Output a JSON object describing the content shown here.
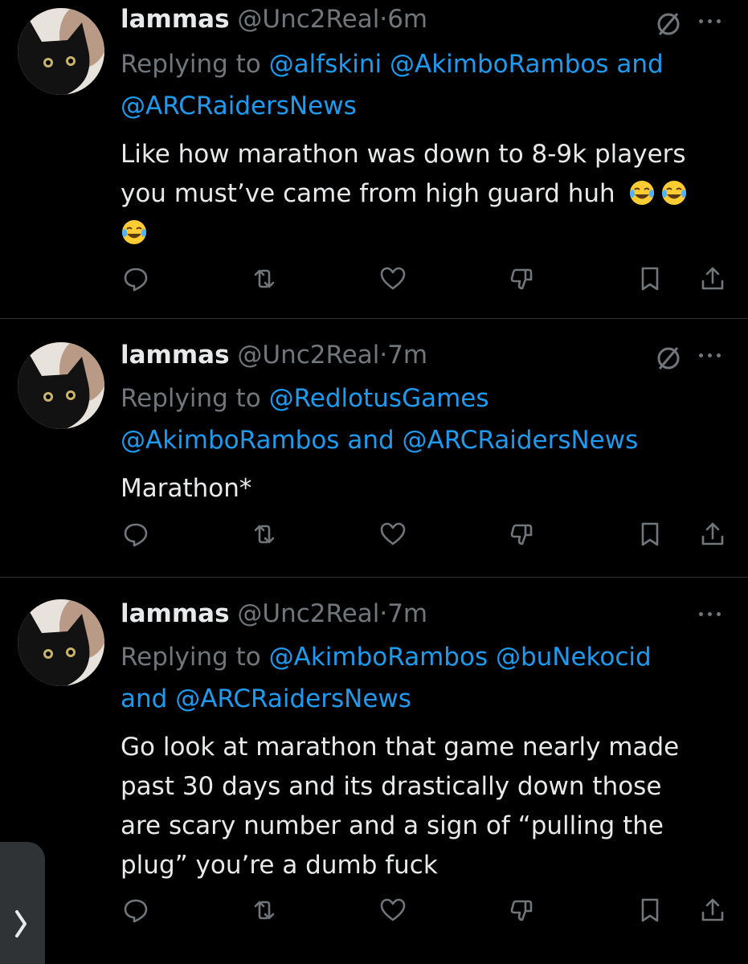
{
  "posts": [
    {
      "name": "lammas",
      "handle": "@Unc2Real",
      "dot": "·",
      "time": "6m",
      "reply_prefix": "Replying to",
      "mentions": [
        "@alfskini",
        "@AkimboRambos"
      ],
      "and": "and",
      "last_mention": "@ARCRaidersNews",
      "text_line1": "Like how marathon was down to 8-9k players",
      "text_line2": "you must’ve came from high guard huh",
      "emojis": [
        "face-with-tears-of-joy",
        "face-with-tears-of-joy",
        "face-with-tears-of-joy"
      ],
      "muted": true
    },
    {
      "name": "lammas",
      "handle": "@Unc2Real",
      "dot": "·",
      "time": "7m",
      "reply_prefix": "Replying to",
      "mentions": [
        "@RedlotusGames",
        "@AkimboRambos"
      ],
      "and": "and",
      "last_mention": "@ARCRaidersNews",
      "text": "Marathon*",
      "muted": true
    },
    {
      "name": "lammas",
      "handle": "@Unc2Real",
      "dot": "·",
      "time": "7m",
      "reply_prefix": "Replying to",
      "mentions": [
        "@AkimboRambos",
        "@buNekocid"
      ],
      "and": "and",
      "last_mention": "@ARCRaidersNews",
      "text_lines": [
        "Go look at marathon that game nearly made",
        "past 30 days and its drastically down those",
        "are scary number and a sign of “pulling the",
        "plug” you’re a dumb fuck"
      ],
      "muted": false
    }
  ],
  "action_icons": [
    "reply-icon",
    "repost-icon",
    "like-icon",
    "dislike-icon",
    "bookmark-icon",
    "share-icon"
  ],
  "colors": {
    "background": "#000000",
    "text": "#e7e9ea",
    "muted": "#71767b",
    "link": "#1d9bf0",
    "divider": "#2f3336"
  }
}
